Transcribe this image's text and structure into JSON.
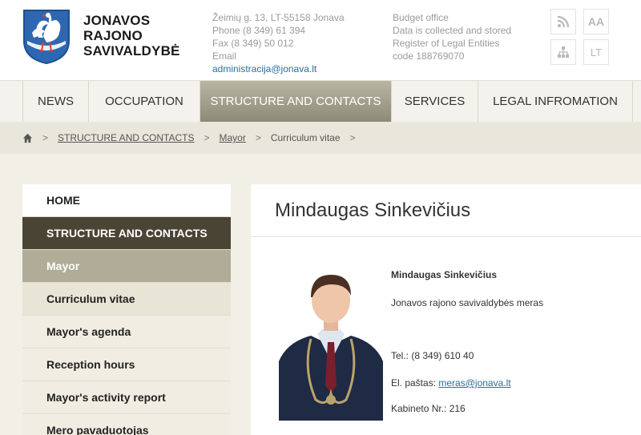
{
  "header": {
    "brand_lines": [
      "JONAVOS",
      "RAJONO",
      "SAVIVALDYBĖ"
    ],
    "address": "Žeimių g. 13, LT-55158 Jonava",
    "phone": "Phone (8 349) 61 394",
    "fax": "Fax (8 349) 50 012",
    "email_label": "Email",
    "email": "administracija@jonava.lt",
    "budget": [
      "Budget office",
      "Data is collected and stored",
      "Register of Legal Entities",
      "code 188769070"
    ],
    "tools": {
      "font_label": "AA",
      "lang_label": "LT"
    }
  },
  "nav": [
    {
      "label": "NEWS"
    },
    {
      "label": "OCCUPATION"
    },
    {
      "label": "STRUCTURE AND CONTACTS",
      "active": true
    },
    {
      "label": "SERVICES"
    },
    {
      "label": "LEGAL INFROMATION"
    }
  ],
  "breadcrumb": {
    "sep": ">",
    "items": [
      "STRUCTURE AND CONTACTS",
      "Mayor",
      "Curriculum vitae"
    ]
  },
  "sidebar": {
    "items": [
      "HOME",
      "STRUCTURE AND CONTACTS",
      "Mayor",
      "Curriculum vitae",
      "Mayor's agenda",
      "Reception hours",
      "Mayor's activity report",
      "Mero pavaduotojas"
    ]
  },
  "content": {
    "title": "Mindaugas Sinkevičius",
    "name": "Mindaugas Sinkevičius",
    "position": "Jonavos rajono savivaldybės meras",
    "tel": "Tel.: (8 349) 610 40",
    "email_label": "El. paštas: ",
    "email": "meras@jonava.lt",
    "office": "Kabineto Nr.: 216"
  },
  "colors": {
    "nav_active": "#a19d8b",
    "sidebar_section": "#4a4434",
    "link": "#2a6f9a"
  }
}
